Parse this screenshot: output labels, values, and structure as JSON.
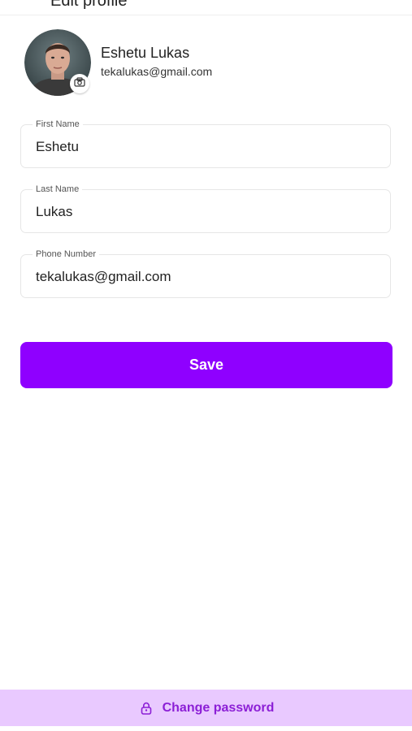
{
  "header": {
    "title": "Edit profile",
    "back_icon": "chevron-left-icon"
  },
  "profile": {
    "name": "Eshetu Lukas",
    "email": "tekalukas@gmail.com",
    "camera_icon": "camera-icon"
  },
  "form": {
    "first_name": {
      "label": "First Name",
      "value": "Eshetu"
    },
    "last_name": {
      "label": "Last Name",
      "value": "Lukas"
    },
    "phone": {
      "label": "Phone Number",
      "value": "tekalukas@gmail.com"
    }
  },
  "actions": {
    "save_label": "Save",
    "change_password_label": "Change password",
    "change_password_icon": "lock-icon"
  },
  "colors": {
    "primary": "#8f00ff",
    "bottom_bar_bg": "#e9c9ff",
    "bottom_bar_text": "#8c1fd6"
  }
}
